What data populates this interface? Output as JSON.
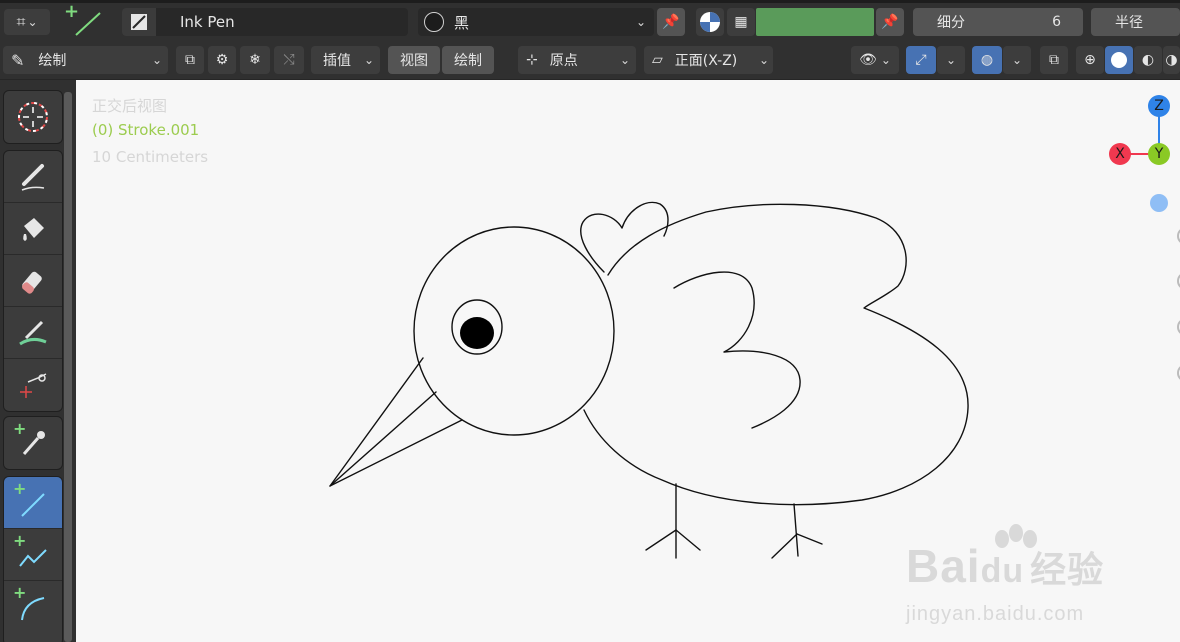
{
  "header": {
    "brush_name": "Ink Pen",
    "material_name": "黑",
    "subdivide_label": "细分",
    "subdivide_value": "6",
    "radius_label": "半径",
    "colors": {
      "bar": "#303030",
      "field": "#282828",
      "button": "#545454",
      "accent": "#4772b3",
      "color_swatch": "#5a9b5a"
    }
  },
  "header2": {
    "mode_label": "绘制",
    "interpolate_label": "插值",
    "view_menu": "视图",
    "draw_menu": "绘制",
    "origin_label": "原点",
    "orientation_label": "正面(X-Z)"
  },
  "viewport": {
    "view_name": "正交后视图",
    "object_label": "(0) Stroke.001",
    "scale_label": "10 Centimeters",
    "axes": {
      "z": "Z",
      "x": "X",
      "y": "Y"
    },
    "axis_colors": {
      "z": "#2f83e8",
      "x": "#f0384f",
      "y": "#8ac925"
    }
  },
  "watermark": {
    "brand": "Bai",
    "brand2": "du",
    "brand_cn": "经验",
    "url": "jingyan.baidu.com"
  }
}
